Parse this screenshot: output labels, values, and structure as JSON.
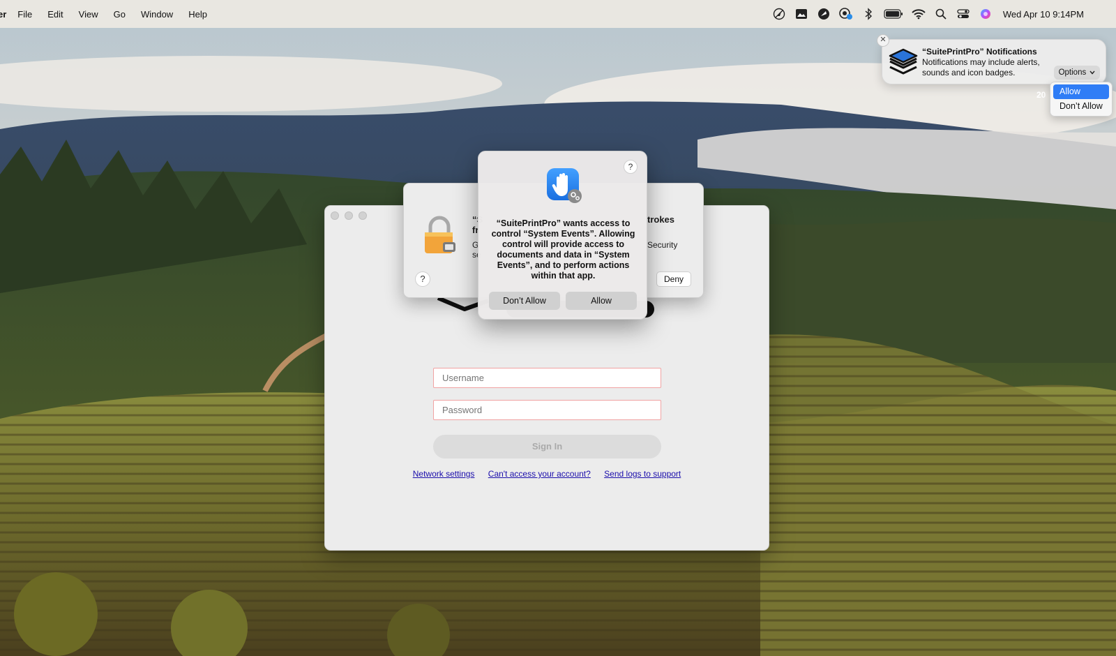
{
  "menubar": {
    "app_name": "er",
    "menus": [
      "File",
      "Edit",
      "View",
      "Go",
      "Window",
      "Help"
    ],
    "status_icons": [
      "no-location-icon",
      "photo-icon",
      "app-icon",
      "cloud-badge-icon",
      "bluetooth-icon",
      "battery-icon",
      "wifi-icon",
      "search-icon",
      "control-center-icon",
      "siri-icon"
    ],
    "clock": "Wed Apr 10  9:14PM"
  },
  "login_window": {
    "username_placeholder": "Username",
    "password_placeholder": "Password",
    "sign_in_label": "Sign In",
    "links": [
      "Network settings",
      "Can't access your account?",
      "Send logs to support"
    ]
  },
  "keystroke_dialog": {
    "visible_fragments": {
      "title_left_1": "“S",
      "title_left_2": "fr",
      "title_right": "trokes",
      "body_left_1": "G",
      "body_left_2": "se",
      "body_right": "Security"
    },
    "help_label": "?",
    "deny_label": "Deny"
  },
  "access_dialog": {
    "help_label": "?",
    "message": "“SuitePrintPro” wants access to control “System Events”. Allowing control will provide access to documents and data in “System Events”, and to perform actions within that app.",
    "dont_allow_label": "Don’t Allow",
    "allow_label": "Allow"
  },
  "notification": {
    "close_label": "✕",
    "title": "“SuitePrintPro” Notifications",
    "body": "Notifications may include alerts, sounds and icon badges.",
    "options_label": "Options",
    "clipped_date": "20",
    "menu": {
      "selected": "Allow",
      "options": [
        "Allow",
        "Don’t Allow"
      ]
    }
  }
}
